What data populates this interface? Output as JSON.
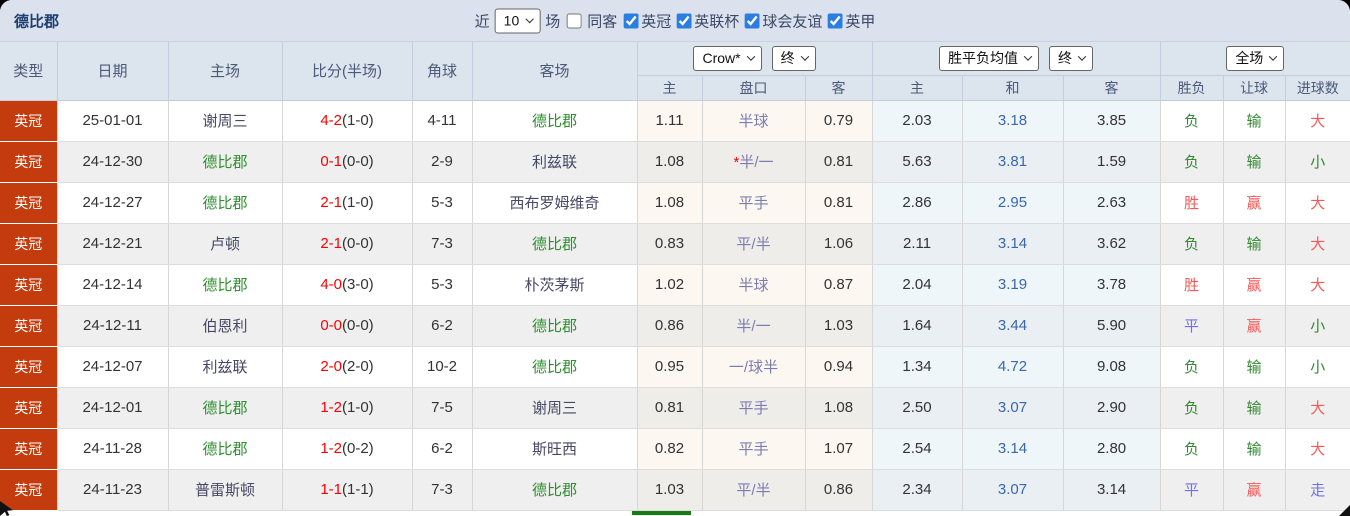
{
  "topbar": {
    "title": "德比郡",
    "near_label": "近",
    "count_value": "10",
    "games_label": "场",
    "same_away_label": "同客",
    "same_away_checked": false,
    "leagues": [
      {
        "label": "英冠",
        "checked": true
      },
      {
        "label": "英联杯",
        "checked": true
      },
      {
        "label": "球会友谊",
        "checked": true
      },
      {
        "label": "英甲",
        "checked": true
      }
    ]
  },
  "selects": {
    "bookmaker": "Crow*",
    "bookmaker_stage": "终",
    "odds_type": "胜平负均值",
    "odds_stage": "终",
    "period": "全场"
  },
  "columns": {
    "type": "类型",
    "date": "日期",
    "home": "主场",
    "score": "比分(半场)",
    "corner": "角球",
    "away": "客场"
  },
  "subcolumns": [
    "主",
    "盘口",
    "客",
    "主",
    "和",
    "客",
    "胜负",
    "让球",
    "进球数"
  ],
  "colors": {
    "red": "#f55a5a",
    "green": "#338a33",
    "blue": "#7070e8",
    "derby": "#2f8e2f",
    "other": "#474766",
    "type_bg": "#c43b0e",
    "handicap": "#7c7cb0",
    "avg_draw": "#3a66b0",
    "score_ft": "#ff0000",
    "title": "#1d3e6f"
  },
  "table": {
    "rows": [
      {
        "type": "英冠",
        "date": "25-01-01",
        "home": "谢周三",
        "home_key": "other",
        "ft": "4-2",
        "ht": "(1-0)",
        "corner": "4-11",
        "away": "德比郡",
        "away_key": "derby",
        "o1": "1.11",
        "star": "",
        "handicap": "半球",
        "o2": "0.79",
        "a1": "2.03",
        "a2": "3.18",
        "a3": "3.85",
        "result": "负",
        "result_key": "green",
        "let": "输",
        "let_key": "green",
        "goal": "大",
        "goal_key": "red"
      },
      {
        "type": "英冠",
        "date": "24-12-30",
        "home": "德比郡",
        "home_key": "derby",
        "ft": "0-1",
        "ht": "(0-0)",
        "corner": "2-9",
        "away": "利兹联",
        "away_key": "other",
        "o1": "1.08",
        "star": "*",
        "handicap": "半/一",
        "o2": "0.81",
        "a1": "5.63",
        "a2": "3.81",
        "a3": "1.59",
        "result": "负",
        "result_key": "green",
        "let": "输",
        "let_key": "green",
        "goal": "小",
        "goal_key": "green"
      },
      {
        "type": "英冠",
        "date": "24-12-27",
        "home": "德比郡",
        "home_key": "derby",
        "ft": "2-1",
        "ht": "(1-0)",
        "corner": "5-3",
        "away": "西布罗姆维奇",
        "away_key": "other",
        "o1": "1.08",
        "star": "",
        "handicap": "平手",
        "o2": "0.81",
        "a1": "2.86",
        "a2": "2.95",
        "a3": "2.63",
        "result": "胜",
        "result_key": "red",
        "let": "赢",
        "let_key": "red",
        "goal": "大",
        "goal_key": "red"
      },
      {
        "type": "英冠",
        "date": "24-12-21",
        "home": "卢顿",
        "home_key": "other",
        "ft": "2-1",
        "ht": "(0-0)",
        "corner": "7-3",
        "away": "德比郡",
        "away_key": "derby",
        "o1": "0.83",
        "star": "",
        "handicap": "平/半",
        "o2": "1.06",
        "a1": "2.11",
        "a2": "3.14",
        "a3": "3.62",
        "result": "负",
        "result_key": "green",
        "let": "输",
        "let_key": "green",
        "goal": "大",
        "goal_key": "red"
      },
      {
        "type": "英冠",
        "date": "24-12-14",
        "home": "德比郡",
        "home_key": "derby",
        "ft": "4-0",
        "ht": "(3-0)",
        "corner": "5-3",
        "away": "朴茨茅斯",
        "away_key": "other",
        "o1": "1.02",
        "star": "",
        "handicap": "半球",
        "o2": "0.87",
        "a1": "2.04",
        "a2": "3.19",
        "a3": "3.78",
        "result": "胜",
        "result_key": "red",
        "let": "赢",
        "let_key": "red",
        "goal": "大",
        "goal_key": "red"
      },
      {
        "type": "英冠",
        "date": "24-12-11",
        "home": "伯恩利",
        "home_key": "other",
        "ft": "0-0",
        "ht": "(0-0)",
        "corner": "6-2",
        "away": "德比郡",
        "away_key": "derby",
        "o1": "0.86",
        "star": "",
        "handicap": "半/一",
        "o2": "1.03",
        "a1": "1.64",
        "a2": "3.44",
        "a3": "5.90",
        "result": "平",
        "result_key": "blue",
        "let": "赢",
        "let_key": "red",
        "goal": "小",
        "goal_key": "green"
      },
      {
        "type": "英冠",
        "date": "24-12-07",
        "home": "利兹联",
        "home_key": "other",
        "ft": "2-0",
        "ht": "(2-0)",
        "corner": "10-2",
        "away": "德比郡",
        "away_key": "derby",
        "o1": "0.95",
        "star": "",
        "handicap": "一/球半",
        "o2": "0.94",
        "a1": "1.34",
        "a2": "4.72",
        "a3": "9.08",
        "result": "负",
        "result_key": "green",
        "let": "输",
        "let_key": "green",
        "goal": "小",
        "goal_key": "green"
      },
      {
        "type": "英冠",
        "date": "24-12-01",
        "home": "德比郡",
        "home_key": "derby",
        "ft": "1-2",
        "ht": "(1-0)",
        "corner": "7-5",
        "away": "谢周三",
        "away_key": "other",
        "o1": "0.81",
        "star": "",
        "handicap": "平手",
        "o2": "1.08",
        "a1": "2.50",
        "a2": "3.07",
        "a3": "2.90",
        "result": "负",
        "result_key": "green",
        "let": "输",
        "let_key": "green",
        "goal": "大",
        "goal_key": "red"
      },
      {
        "type": "英冠",
        "date": "24-11-28",
        "home": "德比郡",
        "home_key": "derby",
        "ft": "1-2",
        "ht": "(0-2)",
        "corner": "6-2",
        "away": "斯旺西",
        "away_key": "other",
        "o1": "0.82",
        "star": "",
        "handicap": "平手",
        "o2": "1.07",
        "a1": "2.54",
        "a2": "3.14",
        "a3": "2.80",
        "result": "负",
        "result_key": "green",
        "let": "输",
        "let_key": "green",
        "goal": "大",
        "goal_key": "red"
      },
      {
        "type": "英冠",
        "date": "24-11-23",
        "home": "普雷斯顿",
        "home_key": "other",
        "ft": "1-1",
        "ht": "(1-1)",
        "corner": "7-3",
        "away": "德比郡",
        "away_key": "derby",
        "o1": "1.03",
        "star": "",
        "handicap": "平/半",
        "o2": "0.86",
        "a1": "2.34",
        "a2": "3.07",
        "a3": "3.14",
        "result": "平",
        "result_key": "blue",
        "let": "赢",
        "let_key": "red",
        "goal": "走",
        "goal_key": "blue"
      }
    ]
  }
}
